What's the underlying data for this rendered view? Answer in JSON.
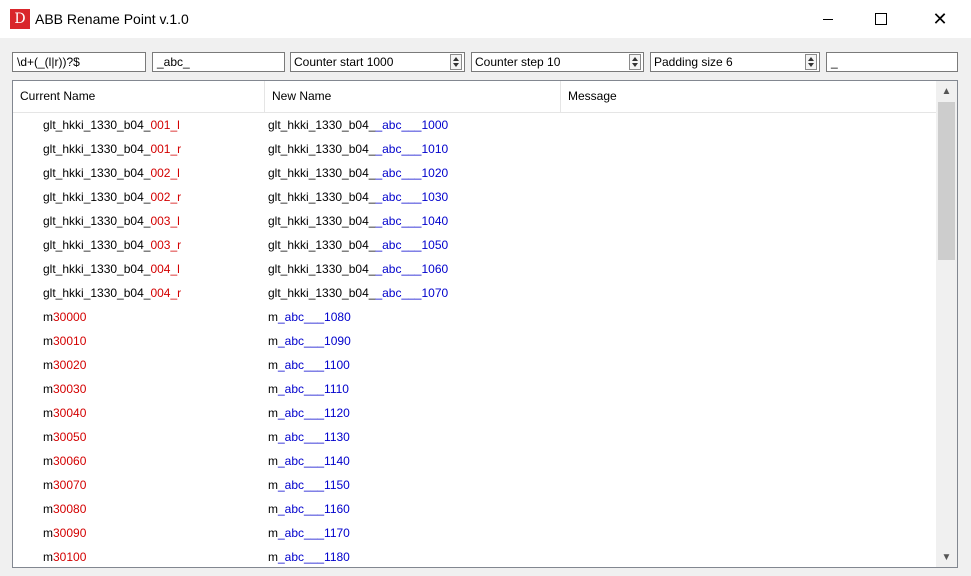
{
  "window": {
    "icon_text": "D",
    "title": "ABB Rename Point v.1.0",
    "minimize": "—",
    "maximize": "□",
    "close": "✕"
  },
  "toolbar": {
    "regex_value": "\\d+(_(l|r))?$",
    "replacement_value": "_abc_",
    "counter_start": "Counter start 1000",
    "counter_step": "Counter step 10",
    "padding_size": "Padding size 6",
    "separator_value": "_"
  },
  "table": {
    "headers": [
      "Current Name",
      "New Name",
      "Message"
    ],
    "rows": [
      {
        "cur_plain": "glt_hkki_1330_b04_",
        "cur_match": "001_l",
        "new_prefix": "glt_hkki_1330_b04_",
        "new_middle": "_abc___",
        "new_num": "1000"
      },
      {
        "cur_plain": "glt_hkki_1330_b04_",
        "cur_match": "001_r",
        "new_prefix": "glt_hkki_1330_b04_",
        "new_middle": "_abc___",
        "new_num": "1010"
      },
      {
        "cur_plain": "glt_hkki_1330_b04_",
        "cur_match": "002_l",
        "new_prefix": "glt_hkki_1330_b04_",
        "new_middle": "_abc___",
        "new_num": "1020"
      },
      {
        "cur_plain": "glt_hkki_1330_b04_",
        "cur_match": "002_r",
        "new_prefix": "glt_hkki_1330_b04_",
        "new_middle": "_abc___",
        "new_num": "1030"
      },
      {
        "cur_plain": "glt_hkki_1330_b04_",
        "cur_match": "003_l",
        "new_prefix": "glt_hkki_1330_b04_",
        "new_middle": "_abc___",
        "new_num": "1040"
      },
      {
        "cur_plain": "glt_hkki_1330_b04_",
        "cur_match": "003_r",
        "new_prefix": "glt_hkki_1330_b04_",
        "new_middle": "_abc___",
        "new_num": "1050"
      },
      {
        "cur_plain": "glt_hkki_1330_b04_",
        "cur_match": "004_l",
        "new_prefix": "glt_hkki_1330_b04_",
        "new_middle": "_abc___",
        "new_num": "1060"
      },
      {
        "cur_plain": "glt_hkki_1330_b04_",
        "cur_match": "004_r",
        "new_prefix": "glt_hkki_1330_b04_",
        "new_middle": "_abc___",
        "new_num": "1070"
      },
      {
        "cur_plain": "m",
        "cur_match": "30000",
        "new_prefix": "m",
        "new_middle": "_abc___",
        "new_num": "1080"
      },
      {
        "cur_plain": "m",
        "cur_match": "30010",
        "new_prefix": "m",
        "new_middle": "_abc___",
        "new_num": "1090"
      },
      {
        "cur_plain": "m",
        "cur_match": "30020",
        "new_prefix": "m",
        "new_middle": "_abc___",
        "new_num": "1100"
      },
      {
        "cur_plain": "m",
        "cur_match": "30030",
        "new_prefix": "m",
        "new_middle": "_abc___",
        "new_num": "1110"
      },
      {
        "cur_plain": "m",
        "cur_match": "30040",
        "new_prefix": "m",
        "new_middle": "_abc___",
        "new_num": "1120"
      },
      {
        "cur_plain": "m",
        "cur_match": "30050",
        "new_prefix": "m",
        "new_middle": "_abc___",
        "new_num": "1130"
      },
      {
        "cur_plain": "m",
        "cur_match": "30060",
        "new_prefix": "m",
        "new_middle": "_abc___",
        "new_num": "1140"
      },
      {
        "cur_plain": "m",
        "cur_match": "30070",
        "new_prefix": "m",
        "new_middle": "_abc___",
        "new_num": "1150"
      },
      {
        "cur_plain": "m",
        "cur_match": "30080",
        "new_prefix": "m",
        "new_middle": "_abc___",
        "new_num": "1160"
      },
      {
        "cur_plain": "m",
        "cur_match": "30090",
        "new_prefix": "m",
        "new_middle": "_abc___",
        "new_num": "1170"
      },
      {
        "cur_plain": "m",
        "cur_match": "30100",
        "new_prefix": "m",
        "new_middle": "_abc___",
        "new_num": "1180"
      }
    ]
  },
  "scrollbar": {
    "up_icon": "chevron-up-icon",
    "down_icon": "chevron-down-icon"
  }
}
